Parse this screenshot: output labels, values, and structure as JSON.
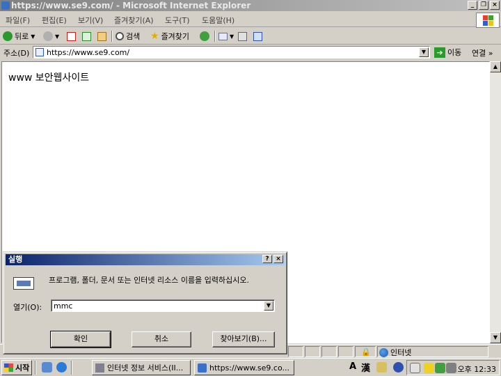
{
  "window": {
    "title": "https://www.se9.com/ - Microsoft Internet Explorer",
    "minimize": "_",
    "restore": "❐",
    "close": "×"
  },
  "menu": [
    "파일(F)",
    "편집(E)",
    "보기(V)",
    "즐겨찾기(A)",
    "도구(T)",
    "도움말(H)"
  ],
  "toolbar": {
    "back": "뒤로",
    "search": "검색",
    "favorites": "즐겨찾기"
  },
  "address": {
    "label": "주소(D)",
    "value": "https://www.se9.com/",
    "go": "이동",
    "links": "연결 »"
  },
  "page": {
    "text": "www 보안웹사이트"
  },
  "status": {
    "zone": "인터넷"
  },
  "run_dialog": {
    "title": "실행",
    "help": "?",
    "close": "×",
    "prompt": "프로그램, 폴더, 문서 또는 인터넷 리소스 이름을 입력하십시오.",
    "open_label": "열기(O):",
    "open_value": "mmc",
    "ok": "확인",
    "cancel": "취소",
    "browse": "찾아보기(B)..."
  },
  "taskbar": {
    "start": "시작",
    "tasks": [
      "인터넷 정보 서비스(II...",
      "https://www.se9.co..."
    ],
    "clock": "오후 12:33",
    "ime": [
      "A",
      "漢"
    ]
  },
  "colors": {
    "title_active": "#0a246a",
    "title_inactive": "#808080",
    "face": "#d4d0c8"
  }
}
